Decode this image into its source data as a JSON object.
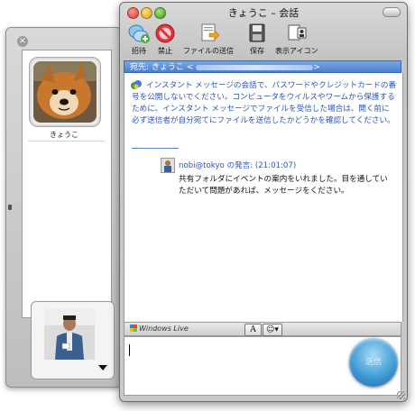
{
  "drawer": {
    "contact_name": "きょうこ"
  },
  "window": {
    "title": "きょうこ – 会話"
  },
  "toolbar": {
    "items": [
      {
        "label": "招待",
        "icon": "invite-icon"
      },
      {
        "label": "禁止",
        "icon": "block-icon"
      },
      {
        "label": "ファイルの送信",
        "icon": "send-file-icon"
      },
      {
        "label": "保存",
        "icon": "save-icon"
      },
      {
        "label": "表示アイコン",
        "icon": "display-icon"
      }
    ]
  },
  "to_bar": {
    "text": "宛先: きょうこ <",
    "suffix": ">"
  },
  "messages": {
    "warning": "インスタント メッセージの会話で、パスワードやクレジットカードの番号を公開しないでください。コンピュータをウイルスやワームから保護するために、インスタント メッセージでファイルを受信した場合は、開く前に必ず送信者が自分宛てにファイルを送信したかどうかを確認してください。",
    "header": "nobi@tokyo の発言: (21:01:07)",
    "body": "共有フォルダにイベントの案内をいれました。目を通していただいて問題があれば、メッセージをください。"
  },
  "input_toolbar": {
    "brand": "Windows Live",
    "font_button": "A",
    "emoticon_button": "☺▾"
  },
  "input": {
    "value": ""
  },
  "send_button": {
    "label": "送信"
  },
  "colors": {
    "accent_blue": "#2a56b8",
    "to_bar_blue": "#4a7fcf"
  }
}
